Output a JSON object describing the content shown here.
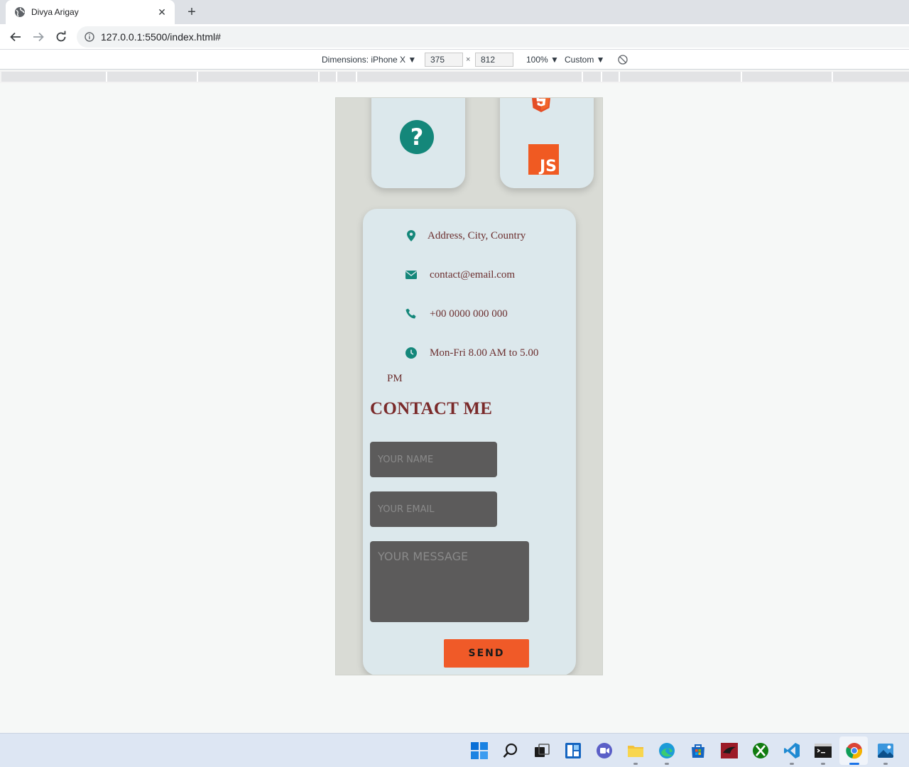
{
  "browser": {
    "tab_title": "Divya Arigay",
    "tab_close": "✕",
    "new_tab": "+",
    "url": "127.0.0.1:5500/index.html#"
  },
  "devtools": {
    "dimensions_label": "Dimensions: iPhone X ▼",
    "width": "375",
    "times": "×",
    "height": "812",
    "zoom": "100% ▼",
    "throttle": "Custom ▼"
  },
  "skills": {
    "left_icon": "question-circle-icon",
    "right_top_icon": "html5-icon",
    "right_bottom_label": "JS"
  },
  "contact_info": {
    "address": "Address, City, Country",
    "email": "contact@email.com",
    "phone": "+00 0000 000 000",
    "hours": "Mon-Fri 8.00 AM to 5.00",
    "hours_wrap": "PM"
  },
  "contact_form": {
    "title": "CONTACT ME",
    "name_placeholder": "YOUR NAME",
    "email_placeholder": "YOUR EMAIL",
    "message_placeholder": "YOUR MESSAGE",
    "send_label": "SEND"
  },
  "colors": {
    "accent_teal": "#14877a",
    "accent_orange": "#f05a28",
    "card_bg": "#dce8ec",
    "heading": "#7a2a2a"
  },
  "taskbar": {
    "icons": [
      "start-icon",
      "search-icon",
      "task-view-icon",
      "widgets-icon",
      "chat-icon",
      "file-explorer-icon",
      "edge-icon",
      "store-icon",
      "app-red-icon",
      "xbox-icon",
      "vscode-icon",
      "terminal-icon",
      "chrome-icon",
      "photos-icon"
    ]
  }
}
